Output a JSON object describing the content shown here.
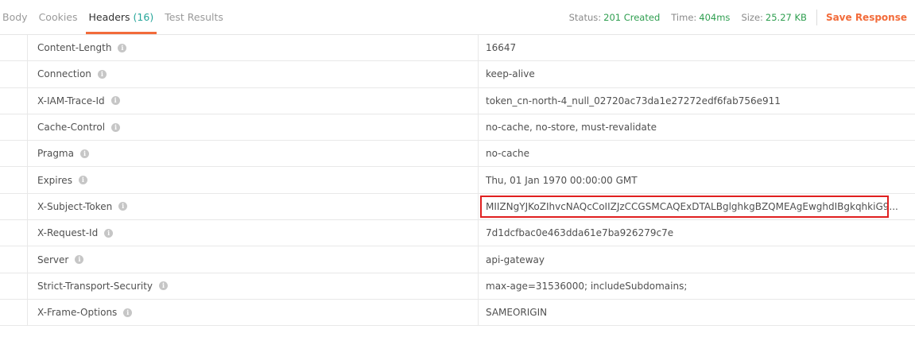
{
  "tabs": [
    {
      "label": "Body",
      "count": ""
    },
    {
      "label": "Cookies",
      "count": ""
    },
    {
      "label": "Headers",
      "count": "(16)"
    },
    {
      "label": "Test Results",
      "count": ""
    }
  ],
  "status": {
    "status_label": "Status:",
    "status_value": "201 Created",
    "time_label": "Time:",
    "time_value": "404ms",
    "size_label": "Size:",
    "size_value": "25.27 KB",
    "save_label": "Save Response"
  },
  "headers": [
    {
      "key": "Content-Length",
      "value": "16647"
    },
    {
      "key": "Connection",
      "value": "keep-alive"
    },
    {
      "key": "X-IAM-Trace-Id",
      "value": "token_cn-north-4_null_02720ac73da1e27272edf6fab756e911"
    },
    {
      "key": "Cache-Control",
      "value": "no-cache, no-store, must-revalidate"
    },
    {
      "key": "Pragma",
      "value": "no-cache"
    },
    {
      "key": "Expires",
      "value": "Thu, 01 Jan 1970 00:00:00 GMT"
    },
    {
      "key": "X-Subject-Token",
      "value": "MIIZNgYJKoZIhvcNAQcCoIIZJzCCGSMCAQExDTALBglghkgBZQMEAgEwghdIBgkqhkiG9..."
    },
    {
      "key": "X-Request-Id",
      "value": "7d1dcfbac0e463dda61e7ba926279c7e"
    },
    {
      "key": "Server",
      "value": "api-gateway"
    },
    {
      "key": "Strict-Transport-Security",
      "value": "max-age=31536000; includeSubdomains;"
    },
    {
      "key": "X-Frame-Options",
      "value": "SAMEORIGIN"
    }
  ],
  "info_icon_glyph": "i",
  "colors": {
    "accent": "#f26b3a",
    "status_green": "#2e9e4f",
    "count_teal": "#26a69a",
    "highlight_red": "#e02020"
  }
}
